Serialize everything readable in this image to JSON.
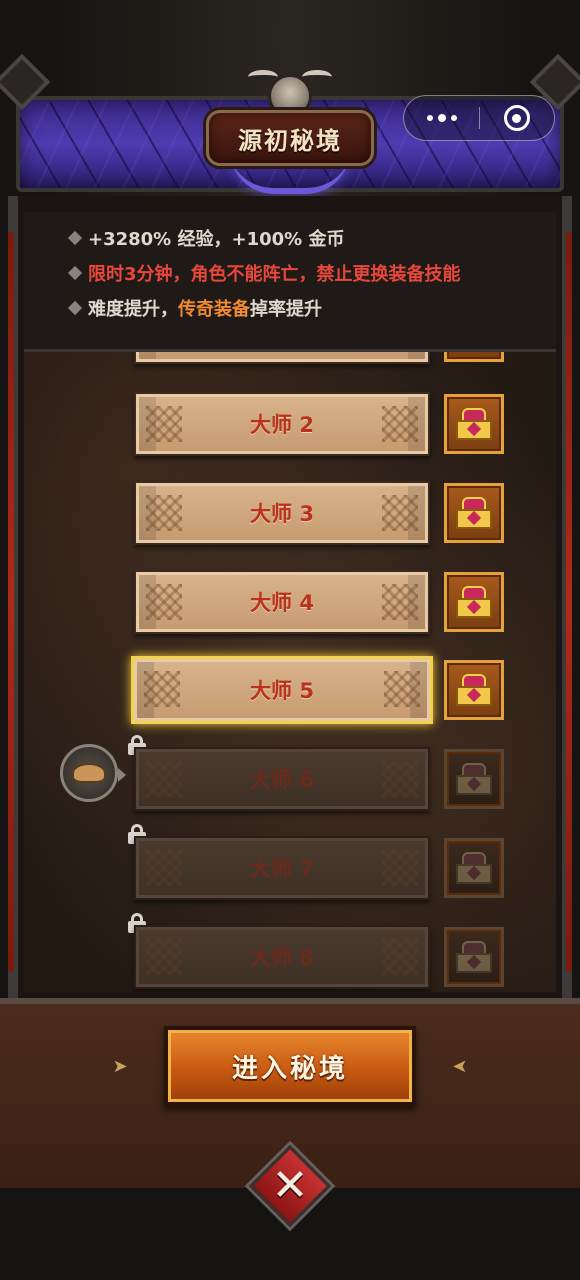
{
  "window": {
    "title": "源初秘境"
  },
  "capsule": {
    "more_icon": "more-dots-icon",
    "close_icon": "target-close-icon"
  },
  "info": {
    "lines": [
      {
        "parts": [
          {
            "text": "+3280% 经验，+100% 金币",
            "color": "#e0d8cc"
          }
        ]
      },
      {
        "parts": [
          {
            "text": "限时3分钟，角色不能阵亡，禁止更换装备技能",
            "color": "#e8483a"
          }
        ]
      },
      {
        "parts": [
          {
            "text": "难度提升，",
            "color": "#e0d8cc"
          },
          {
            "text": "传奇装备",
            "color": "#f08a32"
          },
          {
            "text": " 掉率提升",
            "color": "#e0d8cc"
          }
        ]
      }
    ]
  },
  "levels": [
    {
      "label": "大师 2",
      "state": "unlocked"
    },
    {
      "label": "大师 3",
      "state": "unlocked"
    },
    {
      "label": "大师 4",
      "state": "unlocked"
    },
    {
      "label": "大师 5",
      "state": "selected"
    },
    {
      "label": "大师 6",
      "state": "locked"
    },
    {
      "label": "大师 7",
      "state": "locked"
    },
    {
      "label": "大师 8",
      "state": "locked"
    }
  ],
  "enter_button": {
    "label": "进入秘境"
  },
  "colors": {
    "accent_orange": "#e8882e",
    "selected_gold": "#f2d24a",
    "header_purple": "#4f3bb0"
  }
}
